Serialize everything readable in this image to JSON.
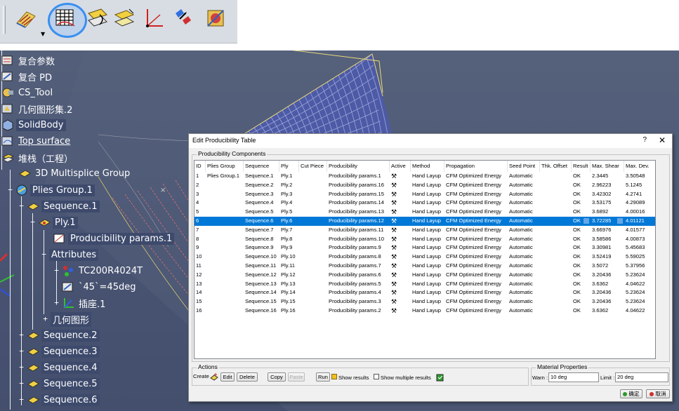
{
  "toolbar": {
    "buttons": [
      {
        "name": "ply-surface-icon",
        "icon": "ply-surface-icon"
      },
      {
        "name": "producibility-table-icon",
        "icon": "producibility-table-icon",
        "active": true
      },
      {
        "name": "flatten-ply-icon",
        "icon": "flatten-ply-icon"
      },
      {
        "name": "ply-exploder-icon",
        "icon": "ply-exploder-icon"
      },
      {
        "name": "axis-system-icon",
        "icon": "axis-system-icon"
      },
      {
        "name": "sequence-icon",
        "icon": "sequence-icon"
      },
      {
        "name": "material-icon",
        "icon": "material-icon"
      }
    ],
    "active_color": "#3a8ff0"
  },
  "tree": {
    "composites_params": "复合参数",
    "composites_pd": "复合 PD",
    "cs_tool": "CS_Tool",
    "geometric_set_2": "几何图形集.2",
    "solid_body": "SolidBody",
    "top_surface": "Top surface",
    "stacking": "堆栈（工程）",
    "multisplice_group": "3D Multisplice Group",
    "plies_group": "Plies Group.1",
    "sequence_1": "Sequence.1",
    "ply_1": "Ply.1",
    "producibility_params": "Producibility params.1",
    "attributes": "Attributes",
    "material": "TC200R4024T",
    "direction": "`45`=45deg",
    "rosette": "插座.1",
    "geometry": "几何图形",
    "sequence_2": "Sequence.2",
    "sequence_3": "Sequence.3",
    "sequence_4": "Sequence.4",
    "sequence_5": "Sequence.5",
    "sequence_6": "Sequence.6"
  },
  "dialog": {
    "title": "Edit Producibility Table",
    "help": "?",
    "close": "✕",
    "components_legend": "Producibility Components",
    "columns": [
      "ID",
      "Plies Group",
      "Sequence",
      "Ply",
      "Cut Piece",
      "Producibility",
      "Active",
      "Method",
      "Propagation",
      "Seed Point",
      "Thk. Offset",
      "Result",
      "Max. Shear",
      "Max. Dev."
    ],
    "rows": [
      {
        "id": "1",
        "group": "Plies Group.1",
        "seq": "Sequence.1",
        "ply": "Ply.1",
        "cut": "",
        "prod": "Producibility params.1",
        "method": "Hand Layup",
        "prop": "CFM Optimized Energy",
        "seed": "Automatic",
        "thk": "",
        "result": "OK",
        "shear": "2.3445",
        "dev": "3.50548"
      },
      {
        "id": "2",
        "group": "",
        "seq": "Sequence.2",
        "ply": "Ply.2",
        "cut": "",
        "prod": "Producibility params.16",
        "method": "Hand Layup",
        "prop": "CFM Optimized Energy",
        "seed": "Automatic",
        "thk": "",
        "result": "OK",
        "shear": "2.96223",
        "dev": "5.1245"
      },
      {
        "id": "3",
        "group": "",
        "seq": "Sequence.3",
        "ply": "Ply.3",
        "cut": "",
        "prod": "Producibility params.15",
        "method": "Hand Layup",
        "prop": "CFM Optimized Energy",
        "seed": "Automatic",
        "thk": "",
        "result": "OK",
        "shear": "3.42302",
        "dev": "4.2741"
      },
      {
        "id": "4",
        "group": "",
        "seq": "Sequence.4",
        "ply": "Ply.4",
        "cut": "",
        "prod": "Producibility params.14",
        "method": "Hand Layup",
        "prop": "CFM Optimized Energy",
        "seed": "Automatic",
        "thk": "",
        "result": "OK",
        "shear": "3.53175",
        "dev": "4.29089"
      },
      {
        "id": "5",
        "group": "",
        "seq": "Sequence.5",
        "ply": "Ply.5",
        "cut": "",
        "prod": "Producibility params.13",
        "method": "Hand Layup",
        "prop": "CFM Optimized Energy",
        "seed": "Automatic",
        "thk": "",
        "result": "OK",
        "shear": "3.6892",
        "dev": "4.00016"
      },
      {
        "id": "6",
        "group": "",
        "seq": "Sequence.6",
        "ply": "Ply.6",
        "cut": "",
        "prod": "Producibility params.12",
        "method": "Hand Layup",
        "prop": "CFM Optimized Energy",
        "seed": "Automatic",
        "thk": "",
        "result": "OK",
        "shear": "3.72285",
        "dev": "4.01121",
        "selected": true
      },
      {
        "id": "7",
        "group": "",
        "seq": "Sequence.7",
        "ply": "Ply.7",
        "cut": "",
        "prod": "Producibility params.11",
        "method": "Hand Layup",
        "prop": "CFM Optimized Energy",
        "seed": "Automatic",
        "thk": "",
        "result": "OK",
        "shear": "3.66976",
        "dev": "4.01577"
      },
      {
        "id": "8",
        "group": "",
        "seq": "Sequence.8",
        "ply": "Ply.8",
        "cut": "",
        "prod": "Producibility params.10",
        "method": "Hand Layup",
        "prop": "CFM Optimized Energy",
        "seed": "Automatic",
        "thk": "",
        "result": "OK",
        "shear": "3.58586",
        "dev": "4.00873"
      },
      {
        "id": "9",
        "group": "",
        "seq": "Sequence.9",
        "ply": "Ply.9",
        "cut": "",
        "prod": "Producibility params.9",
        "method": "Hand Layup",
        "prop": "CFM Optimized Energy",
        "seed": "Automatic",
        "thk": "",
        "result": "OK",
        "shear": "3.30981",
        "dev": "5.45683"
      },
      {
        "id": "10",
        "group": "",
        "seq": "Sequence.10",
        "ply": "Ply.10",
        "cut": "",
        "prod": "Producibility params.8",
        "method": "Hand Layup",
        "prop": "CFM Optimized Energy",
        "seed": "Automatic",
        "thk": "",
        "result": "OK",
        "shear": "3.52419",
        "dev": "5.59025"
      },
      {
        "id": "11",
        "group": "",
        "seq": "Sequence.11",
        "ply": "Ply.11",
        "cut": "",
        "prod": "Producibility params.7",
        "method": "Hand Layup",
        "prop": "CFM Optimized Energy",
        "seed": "Automatic",
        "thk": "",
        "result": "OK",
        "shear": "3.5072",
        "dev": "5.37956"
      },
      {
        "id": "12",
        "group": "",
        "seq": "Sequence.12",
        "ply": "Ply.12",
        "cut": "",
        "prod": "Producibility params.6",
        "method": "Hand Layup",
        "prop": "CFM Optimized Energy",
        "seed": "Automatic",
        "thk": "",
        "result": "OK",
        "shear": "3.20436",
        "dev": "5.23624"
      },
      {
        "id": "13",
        "group": "",
        "seq": "Sequence.13",
        "ply": "Ply.13",
        "cut": "",
        "prod": "Producibility params.5",
        "method": "Hand Layup",
        "prop": "CFM Optimized Energy",
        "seed": "Automatic",
        "thk": "",
        "result": "OK",
        "shear": "3.6362",
        "dev": "4.04622"
      },
      {
        "id": "14",
        "group": "",
        "seq": "Sequence.14",
        "ply": "Ply.14",
        "cut": "",
        "prod": "Producibility params.4",
        "method": "Hand Layup",
        "prop": "CFM Optimized Energy",
        "seed": "Automatic",
        "thk": "",
        "result": "OK",
        "shear": "3.20436",
        "dev": "5.23624"
      },
      {
        "id": "15",
        "group": "",
        "seq": "Sequence.15",
        "ply": "Ply.15",
        "cut": "",
        "prod": "Producibility params.3",
        "method": "Hand Layup",
        "prop": "CFM Optimized Energy",
        "seed": "Automatic",
        "thk": "",
        "result": "OK",
        "shear": "3.20436",
        "dev": "5.23624"
      },
      {
        "id": "16",
        "group": "",
        "seq": "Sequence.16",
        "ply": "Ply.16",
        "cut": "",
        "prod": "Producibility params.2",
        "method": "Hand Layup",
        "prop": "CFM Optimized Energy",
        "seed": "Automatic",
        "thk": "",
        "result": "OK",
        "shear": "3.6362",
        "dev": "4.04622"
      }
    ],
    "actions": {
      "legend": "Actions",
      "create": "Create",
      "edit": "Edit",
      "delete": "Delete",
      "copy": "Copy",
      "paste": "Paste",
      "run": "Run",
      "show_results": "Show results",
      "show_multiple_results": "Show multiple results"
    },
    "material": {
      "legend": "Material Properties",
      "warn_label": "Warn :",
      "warn_value": "10 deg",
      "limit_label": "Limit :",
      "limit_value": "20 deg"
    },
    "ok": "确定",
    "cancel": "取消",
    "selection_color": "#0078d7"
  }
}
